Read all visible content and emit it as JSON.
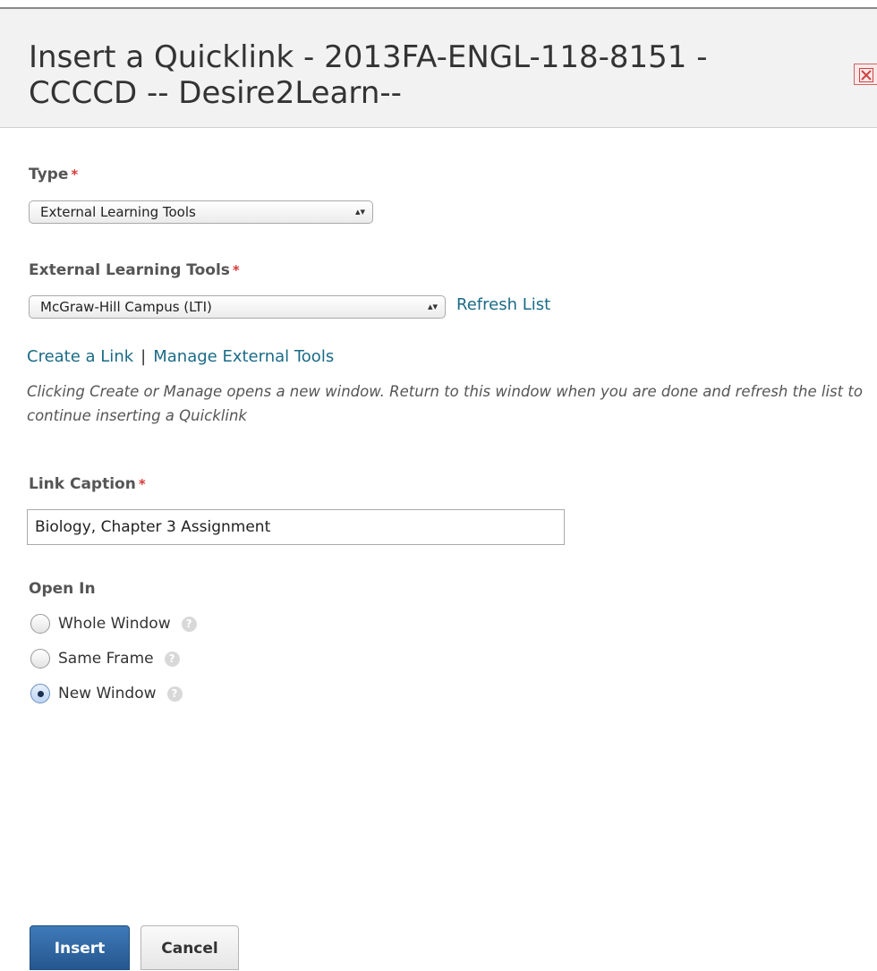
{
  "dialog": {
    "title_line1": "Insert a Quicklink - 2013FA-ENGL-118-8151 -",
    "title_line2": "CCCCD -- Desire2Learn--"
  },
  "form": {
    "type": {
      "label": "Type",
      "required_marker": "*",
      "selected": "External Learning Tools"
    },
    "external_tools": {
      "label": "External Learning Tools",
      "required_marker": "*",
      "selected": "McGraw-Hill Campus (LTI)",
      "refresh_label": "Refresh List"
    },
    "links": {
      "create": "Create a Link",
      "separator": "|",
      "manage": "Manage External Tools"
    },
    "hint_text": "Clicking Create or Manage opens a new window. Return to this window when you are done and refresh the list to continue inserting a Quicklink",
    "caption": {
      "label": "Link Caption",
      "required_marker": "*",
      "value": "Biology, Chapter 3 Assignment"
    },
    "open_in": {
      "label": "Open In",
      "options": [
        {
          "label": "Whole Window",
          "checked": false
        },
        {
          "label": "Same Frame",
          "checked": false
        },
        {
          "label": "New Window",
          "checked": true
        }
      ],
      "help_glyph": "?"
    }
  },
  "buttons": {
    "insert": "Insert",
    "cancel": "Cancel"
  },
  "colors": {
    "link": "#1a6b86",
    "required": "#d63b3b",
    "primary_button": "#2d66a2"
  },
  "icons": {
    "close": "close-x-icon",
    "help": "question-mark-help-icon",
    "select_arrows": "up-down-arrows-icon"
  }
}
